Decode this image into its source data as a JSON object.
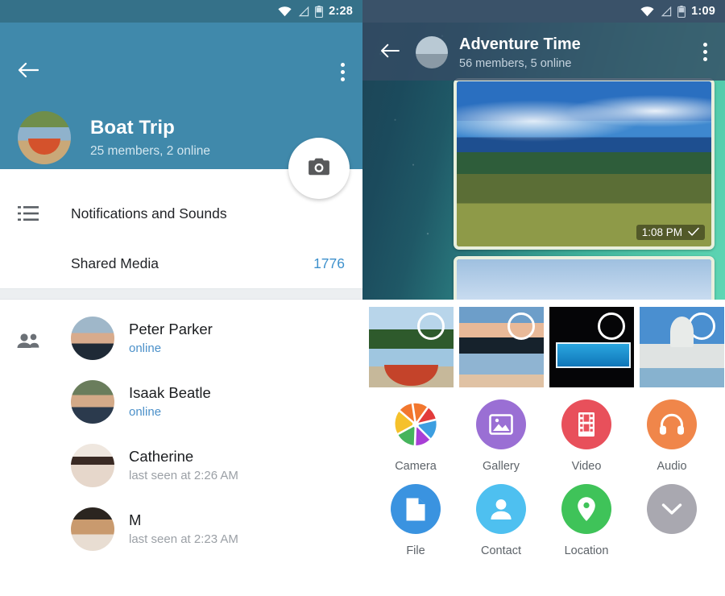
{
  "left": {
    "statusbar": {
      "time": "2:28",
      "icons": [
        "wifi-icon",
        "signal-icon",
        "battery-icon"
      ]
    },
    "header": {
      "back": "back-arrow-icon",
      "menu": "overflow-menu-icon",
      "avatar": "group-avatar-boat",
      "title": "Boat Trip",
      "subtitle": "25 members, 2 online",
      "fab": "camera-icon",
      "bg_color": "#4089ab",
      "statusbar_color": "#357189"
    },
    "rows": [
      {
        "icon": "notifications-list-icon",
        "label": "Notifications and Sounds",
        "value": ""
      },
      {
        "icon": "",
        "label": "Shared Media",
        "value": "1776"
      }
    ],
    "members_icon": "people-icon",
    "members": [
      {
        "name": "Peter Parker",
        "status": "online",
        "online": true
      },
      {
        "name": "Isaak Beatle",
        "status": "online",
        "online": true
      },
      {
        "name": "Catherine",
        "status": "last seen at 2:26 AM",
        "online": false
      },
      {
        "name": "M",
        "status": "last seen at 2:23 AM",
        "online": false
      }
    ],
    "accent_color": "#3d90cc"
  },
  "right": {
    "statusbar": {
      "time": "1:09",
      "icons": [
        "wifi-icon",
        "signal-icon",
        "battery-icon"
      ]
    },
    "header": {
      "back": "back-arrow-icon",
      "menu": "overflow-menu-icon",
      "avatar": "group-avatar-ship",
      "title": "Adventure Time",
      "subtitle": "56 members, 5 online",
      "bg_color": "rgba(52,76,100,.82)",
      "statusbar_color": "#3a5269"
    },
    "messages": [
      {
        "type": "photo",
        "scene": "volcano-crater-photo",
        "time": "1:08 PM",
        "check": "sent-check-icon"
      },
      {
        "type": "photo",
        "scene": "blue-photo",
        "time": "",
        "check": ""
      }
    ],
    "thumbnails": [
      {
        "scene": "red-boat-lake-photo",
        "selector": "selection-circle"
      },
      {
        "scene": "lake-sunset-photo",
        "selector": "selection-circle"
      },
      {
        "scene": "night-pool-photo",
        "selector": "selection-circle"
      },
      {
        "scene": "venice-basilica-photo",
        "selector": "selection-circle"
      },
      {
        "scene": "partial-photo",
        "selector": ""
      }
    ],
    "attachments": [
      {
        "label": "Camera",
        "icon": "camera-aperture-icon",
        "color": "multicolor"
      },
      {
        "label": "Gallery",
        "icon": "image-icon",
        "color": "#9a6fd4"
      },
      {
        "label": "Video",
        "icon": "film-icon",
        "color": "#e8505b"
      },
      {
        "label": "Audio",
        "icon": "headphones-icon",
        "color": "#f0864a"
      },
      {
        "label": "File",
        "icon": "document-icon",
        "color": "#3a93e0"
      },
      {
        "label": "Contact",
        "icon": "person-icon",
        "color": "#4ec0f0"
      },
      {
        "label": "Location",
        "icon": "map-pin-icon",
        "color": "#3fc359"
      },
      {
        "label": "",
        "icon": "chevron-down-icon",
        "color": "#a9a8b0"
      }
    ]
  }
}
